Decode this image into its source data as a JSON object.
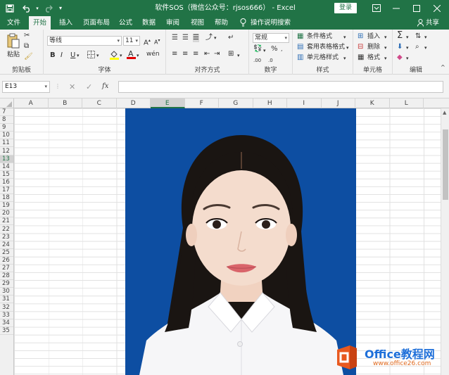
{
  "window": {
    "title": "软件SOS（微信公众号：rjsos666） - Excel",
    "login_label": "登录",
    "brand_color": "#217346"
  },
  "quick_access": {
    "save_icon": "save-icon",
    "undo_icon": "undo-icon",
    "redo_icon": "redo-icon",
    "customize_icon": "customize-icon"
  },
  "window_controls": {
    "ribbon_options_icon": "ribbon-display-icon",
    "minimize_icon": "minimize-icon",
    "maximize_icon": "maximize-icon",
    "close_icon": "close-icon"
  },
  "tabs": [
    {
      "label": "文件",
      "active": false
    },
    {
      "label": "开始",
      "active": true
    },
    {
      "label": "插入",
      "active": false
    },
    {
      "label": "页面布局",
      "active": false
    },
    {
      "label": "公式",
      "active": false
    },
    {
      "label": "数据",
      "active": false
    },
    {
      "label": "审阅",
      "active": false
    },
    {
      "label": "视图",
      "active": false
    },
    {
      "label": "帮助",
      "active": false
    }
  ],
  "tell_me": "操作说明搜索",
  "share": "共享",
  "ribbon": {
    "clipboard": {
      "label": "剪贴板",
      "paste": "粘贴"
    },
    "font": {
      "label": "字体",
      "font_name": "等线",
      "font_size": "11",
      "bold": "B",
      "italic": "I",
      "underline": "U"
    },
    "alignment": {
      "label": "对齐方式"
    },
    "number": {
      "label": "数字",
      "format": "常规",
      "percent": "%"
    },
    "styles": {
      "label": "样式",
      "conditional": "条件格式",
      "table": "套用表格格式",
      "cell_styles": "单元格样式"
    },
    "cells": {
      "label": "单元格",
      "insert": "插入",
      "delete": "删除",
      "format": "格式"
    },
    "editing": {
      "label": "编辑"
    }
  },
  "formula_bar": {
    "name_box": "E13",
    "fx_label": "fx",
    "formula": ""
  },
  "grid": {
    "columns": [
      "A",
      "B",
      "C",
      "D",
      "E",
      "F",
      "G",
      "H",
      "I",
      "J",
      "K",
      "L"
    ],
    "selected_column": "E",
    "rows": [
      "7",
      "8",
      "9",
      "10",
      "11",
      "12",
      "13",
      "14",
      "15",
      "16",
      "17",
      "18",
      "19",
      "20",
      "21",
      "22",
      "23",
      "24",
      "25",
      "26",
      "27",
      "28",
      "29",
      "30",
      "31",
      "32",
      "33",
      "34",
      "35"
    ],
    "selected_row": "13",
    "photo_background": "#0d4ea2"
  },
  "watermark": {
    "brand_text": "Office教程网",
    "url_text": "www.office26.com"
  }
}
